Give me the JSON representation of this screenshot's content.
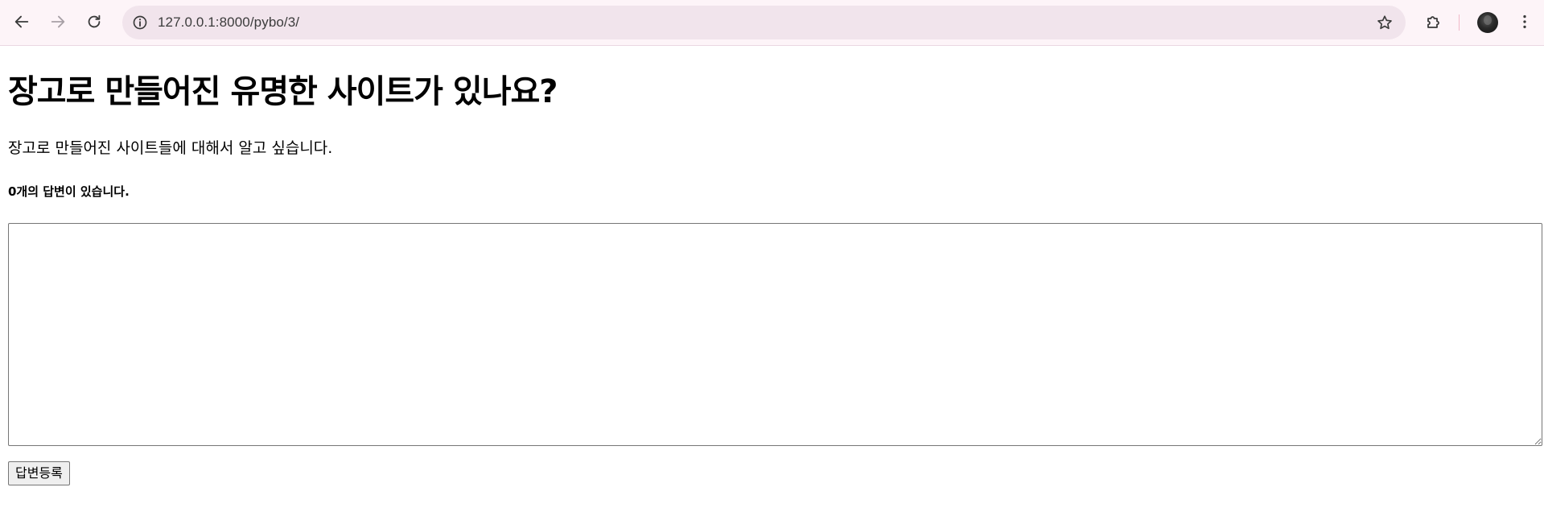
{
  "browser": {
    "url": "127.0.0.1:8000/pybo/3/",
    "icons": {
      "back": "arrow-left-icon",
      "forward": "arrow-right-icon",
      "reload": "reload-icon",
      "site_info": "info-icon",
      "bookmark": "star-icon",
      "extensions": "puzzle-icon",
      "menu": "kebab-menu-icon"
    },
    "colors": {
      "toolbar_bg": "#fdf4f8",
      "omnibox_bg": "#f1e4ec"
    }
  },
  "question": {
    "subject": "장고로 만들어진 유명한 사이트가 있나요?",
    "content": "장고로 만들어진 사이트들에 대해서 알고 싶습니다."
  },
  "answers": {
    "count_text": "0개의 답변이 있습니다."
  },
  "form": {
    "textarea_value": "",
    "submit_label": "답변등록"
  }
}
